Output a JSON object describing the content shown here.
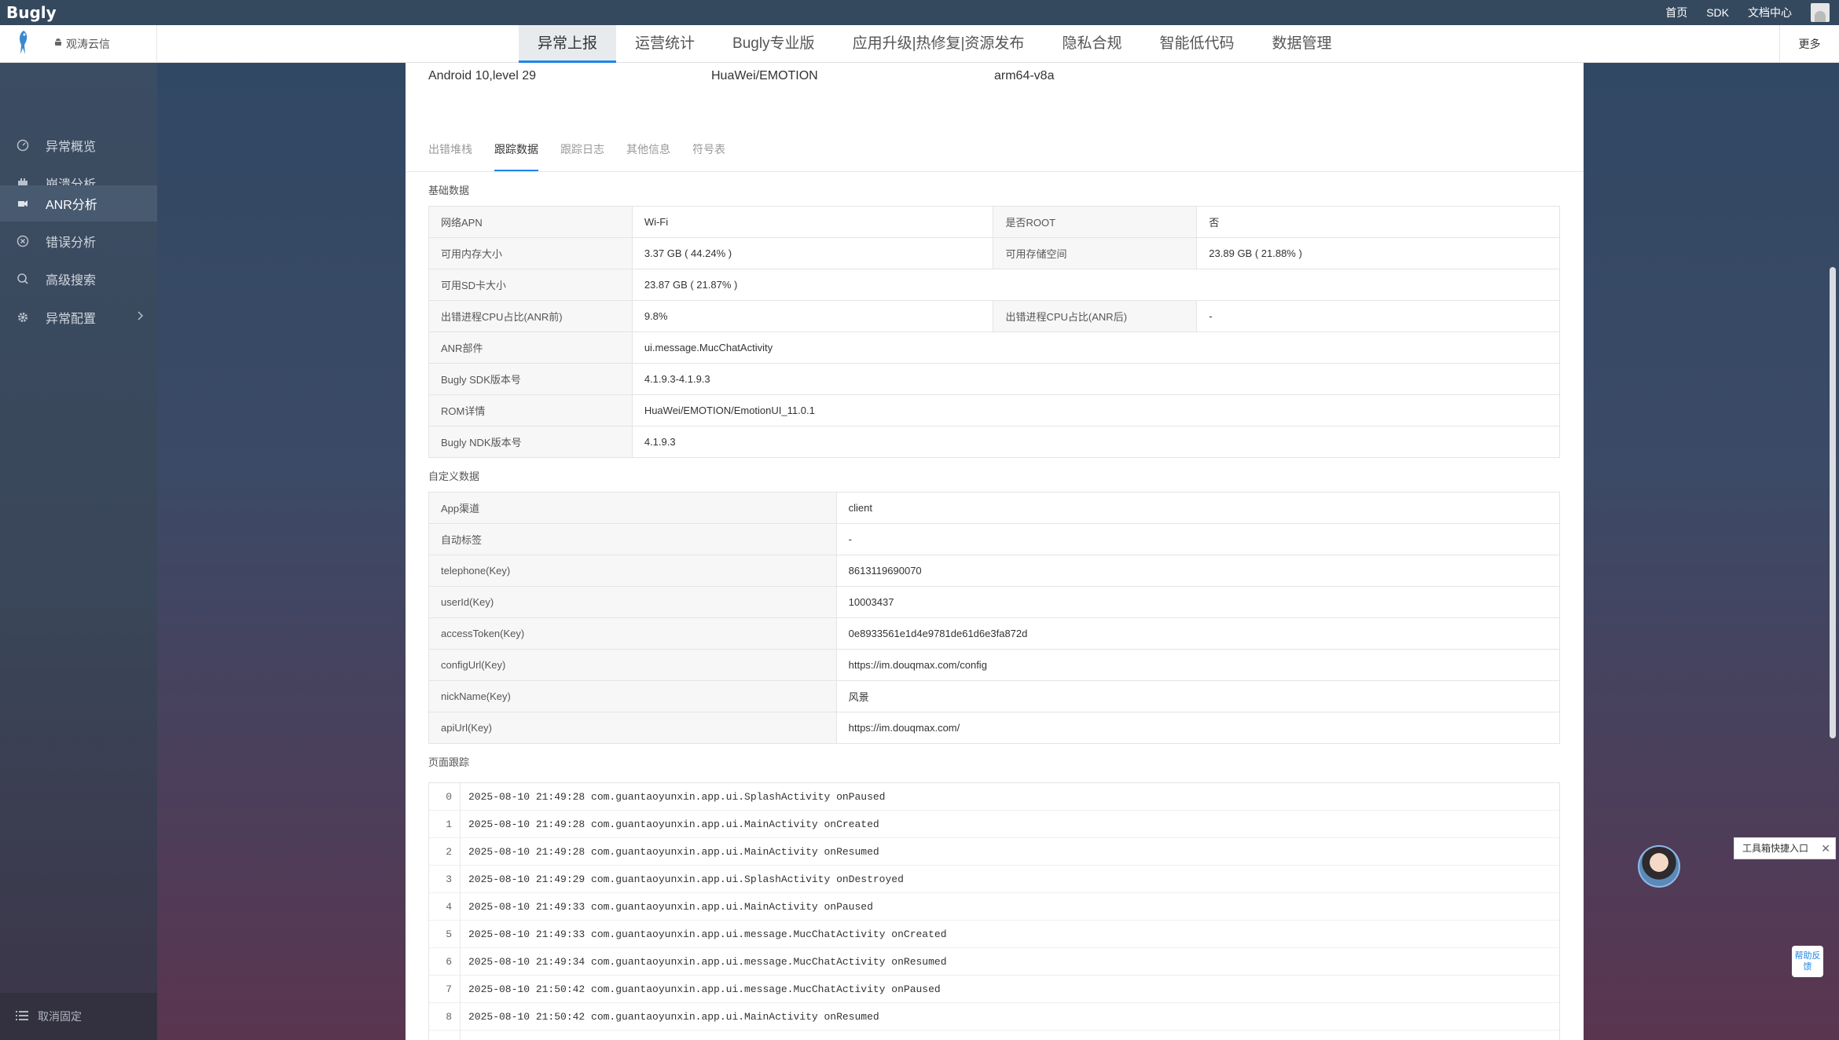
{
  "topbar": {
    "logo": "Bugly",
    "links": [
      "首页",
      "SDK",
      "文档中心"
    ]
  },
  "navbar": {
    "app_name": "观涛云信",
    "tabs": [
      "异常上报",
      "运营统计",
      "Bugly专业版",
      "应用升级|热修复|资源发布",
      "隐私合规",
      "智能低代码",
      "数据管理"
    ],
    "active_tab": "异常上报",
    "more": "更多"
  },
  "sidebar": {
    "items": [
      {
        "label": "异常概览",
        "icon": "gauge-icon"
      },
      {
        "label": "崩溃分析",
        "icon": "crash-icon"
      },
      {
        "label": "ANR分析",
        "icon": "anr-icon",
        "active": true
      },
      {
        "label": "错误分析",
        "icon": "error-circle-icon"
      },
      {
        "label": "高级搜索",
        "icon": "search-icon"
      },
      {
        "label": "异常配置",
        "icon": "gear-icon",
        "has_arrow": true
      }
    ],
    "unpin": "取消固定"
  },
  "device": {
    "os": "Android 10,level 29",
    "model": "HuaWei/EMOTION",
    "arch": "arm64-v8a"
  },
  "subtabs": [
    "出错堆栈",
    "跟踪数据",
    "跟踪日志",
    "其他信息",
    "符号表"
  ],
  "active_subtab": "跟踪数据",
  "basic": {
    "title": "基础数据",
    "rows": [
      [
        "网络APN",
        "Wi-Fi",
        "是否ROOT",
        "否"
      ],
      [
        "可用内存大小",
        "3.37 GB ( 44.24% )",
        "可用存储空间",
        "23.89 GB ( 21.88% )"
      ],
      [
        "可用SD卡大小",
        "23.87 GB ( 21.87% )"
      ],
      [
        "出错进程CPU占比(ANR前)",
        "9.8%",
        "出错进程CPU占比(ANR后)",
        "-"
      ],
      [
        "ANR部件",
        "ui.message.MucChatActivity"
      ],
      [
        "Bugly SDK版本号",
        "4.1.9.3-4.1.9.3"
      ],
      [
        "ROM详情",
        "HuaWei/EMOTION/EmotionUI_11.0.1"
      ],
      [
        "Bugly NDK版本号",
        "4.1.9.3"
      ]
    ]
  },
  "custom": {
    "title": "自定义数据",
    "rows": [
      [
        "App渠道",
        "client"
      ],
      [
        "自动标签",
        "-"
      ],
      [
        "telephone(Key)",
        "8613119690070"
      ],
      [
        "userId(Key)",
        "10003437"
      ],
      [
        "accessToken(Key)",
        "0e8933561e1d4e9781de61d6e3fa872d"
      ],
      [
        "configUrl(Key)",
        "https://im.douqmax.com/config"
      ],
      [
        "nickName(Key)",
        "风景"
      ],
      [
        "apiUrl(Key)",
        "https://im.douqmax.com/"
      ]
    ]
  },
  "trace": {
    "title": "页面跟踪",
    "lines": [
      "2025-08-10 21:49:28 com.guantaoyunxin.app.ui.SplashActivity onPaused",
      "2025-08-10 21:49:28 com.guantaoyunxin.app.ui.MainActivity onCreated",
      "2025-08-10 21:49:28 com.guantaoyunxin.app.ui.MainActivity onResumed",
      "2025-08-10 21:49:29 com.guantaoyunxin.app.ui.SplashActivity onDestroyed",
      "2025-08-10 21:49:33 com.guantaoyunxin.app.ui.MainActivity onPaused",
      "2025-08-10 21:49:33 com.guantaoyunxin.app.ui.message.MucChatActivity onCreated",
      "2025-08-10 21:49:34 com.guantaoyunxin.app.ui.message.MucChatActivity onResumed",
      "2025-08-10 21:50:42 com.guantaoyunxin.app.ui.message.MucChatActivity onPaused",
      "2025-08-10 21:50:42 com.guantaoyunxin.app.ui.MainActivity onResumed"
    ]
  },
  "floating": {
    "tip": "工具箱快捷入口",
    "help": "帮助反馈"
  },
  "colors": {
    "accent": "#1e86e8",
    "topbar": "#34495e"
  }
}
